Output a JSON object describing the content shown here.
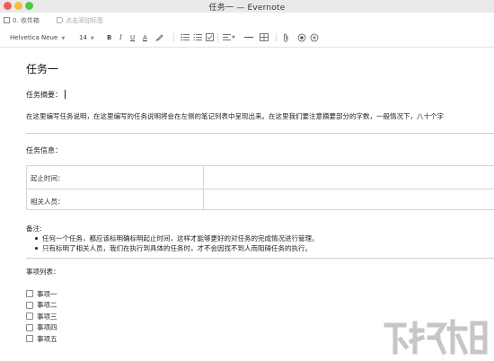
{
  "window": {
    "title": "任务一 — Evernote"
  },
  "metabar": {
    "notebook_label": "0. 收件箱",
    "tag_placeholder": "点击添加标签"
  },
  "toolbar": {
    "font_name": "Helvetica Neue",
    "font_size": "14",
    "bold": "B",
    "italic": "I",
    "underline": "U",
    "text_color": "A"
  },
  "note": {
    "title": "任务一",
    "summary_label": "任务摘要：",
    "description": "在这里编写任务说明，在这里编写的任务说明将会在左侧的笔记列表中呈现出来。在这里我们要注意摘要部分的字数，一般情况下，八十个字",
    "info_title": "任务信息：",
    "info_rows": [
      {
        "label": "起止时间：",
        "value": ""
      },
      {
        "label": "相关人员：",
        "value": ""
      }
    ],
    "remarks_label": "备注:",
    "remarks": [
      "任何一个任务，都应该标明确标明起止时间，这样才能够更好的对任务的完成情况进行管理。",
      "只有标明了相关人员，我们在执行到具体的任务时，才不会因找不到人而阻碍任务的执行。"
    ],
    "items_title": "事项列表：",
    "items": [
      {
        "label": "事项一",
        "checked": false
      },
      {
        "label": "事项二",
        "checked": false
      },
      {
        "label": "事项三",
        "checked": false
      },
      {
        "label": "事项四",
        "checked": false
      },
      {
        "label": "事项五",
        "checked": false
      }
    ]
  },
  "icons": {
    "close": "close-icon",
    "minimize": "minimize-icon",
    "maximize": "maximize-icon",
    "notebook": "notebook-icon",
    "tag": "tag-icon",
    "highlighter": "highlighter-icon",
    "bullet_list": "bullet-list-icon",
    "numbered_list": "numbered-list-icon",
    "checkbox": "checkbox-icon",
    "align": "align-icon",
    "divider": "horizontal-rule-icon",
    "table": "table-icon",
    "attachment": "attachment-icon",
    "record": "record-icon",
    "more": "more-icon"
  },
  "colors": {
    "close": "#ee5d56",
    "minimize": "#f5bd3a",
    "maximize": "#4fc846"
  }
}
